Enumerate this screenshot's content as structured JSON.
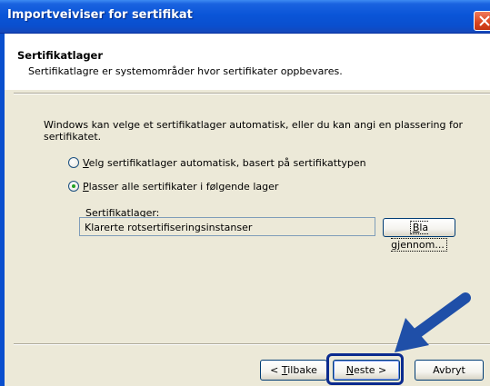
{
  "window": {
    "title": "Importveiviser for sertifikat"
  },
  "header": {
    "title": "Sertifikatlager",
    "subtitle": "Sertifikatlagre er systemområder hvor sertifikater oppbevares."
  },
  "body": {
    "intro_line1": "Windows kan velge et sertifikatlager automatisk, eller du kan angi en plassering for",
    "intro_line2": "sertifikatet.",
    "radio_auto": {
      "access_key": "V",
      "label_rest": "elg sertifikatlager automatisk, basert på sertifikattypen",
      "selected": false
    },
    "radio_manual": {
      "access_key": "P",
      "label_rest": "lasser alle sertifikater i følgende lager",
      "selected": true
    },
    "store_label": "Sertifikatlager:",
    "store_value": "Klarerte rotsertifiseringsinstanser",
    "browse": {
      "access_key": "B",
      "label_rest": "la gjennom..."
    }
  },
  "footer": {
    "back": {
      "prefix": "< ",
      "access_key": "T",
      "label_rest": "ilbake"
    },
    "next": {
      "access_key": "N",
      "label_rest": "este >"
    },
    "cancel": "Avbryt"
  },
  "annotation": {
    "arrow_color": "#1f4fa8",
    "highlight_color": "#0b2b8f"
  }
}
